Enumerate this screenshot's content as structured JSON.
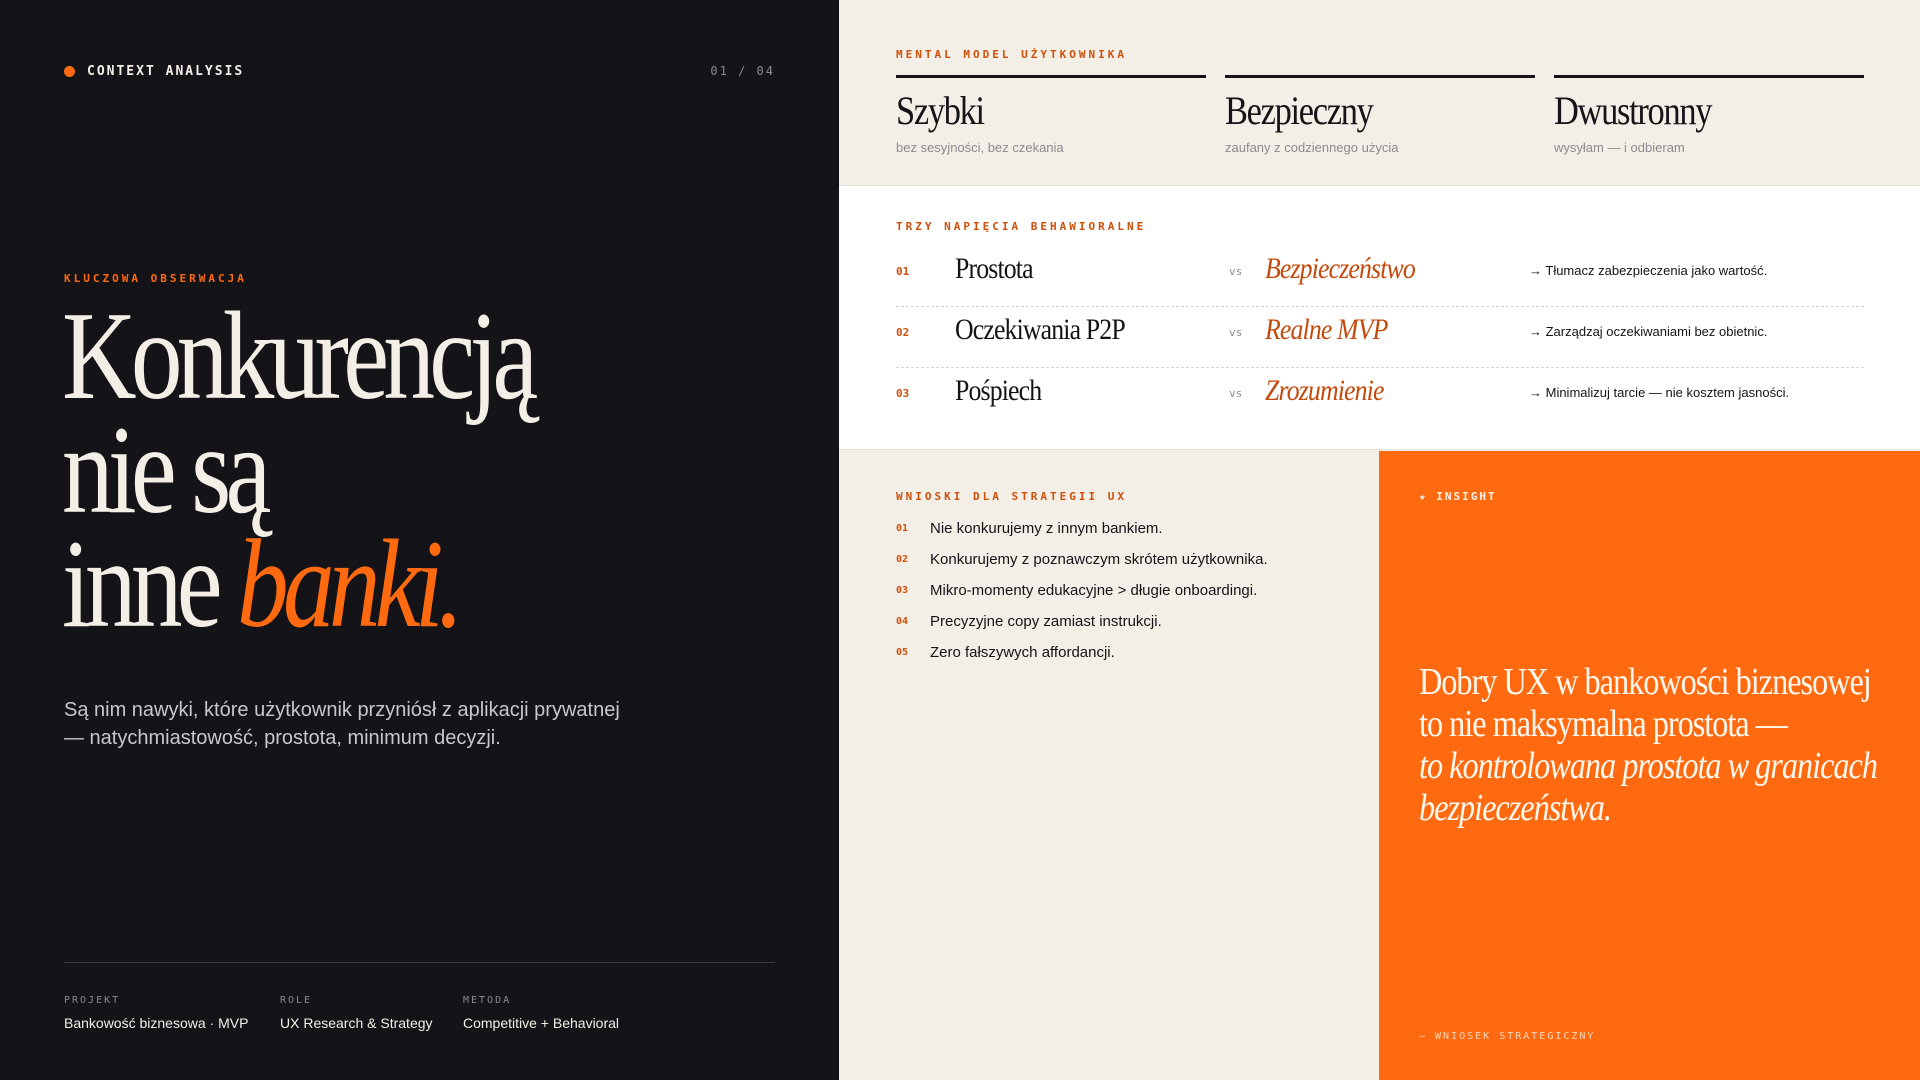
{
  "left": {
    "context_label": "CONTEXT ANALYSIS",
    "pager": "01 / 04",
    "kicker": "KLUCZOWA OBSERWACJA",
    "headline_line1": "Konkurencją",
    "headline_line2": "nie są",
    "headline_line3": "inne",
    "headline_accent": "banki.",
    "lead": "Są nim nawyki, które użytkownik przyniósł z aplikacji prywatnej — natychmiastowość, prostota, minimum decyzji.",
    "meta": [
      {
        "label": "PROJEKT",
        "value": "Bankowość biznesowa · MVP"
      },
      {
        "label": "ROLE",
        "value": "UX Research & Strategy"
      },
      {
        "label": "METODA",
        "value": "Competitive + Behavioral"
      }
    ]
  },
  "mental_model": {
    "label": "MENTAL MODEL UŻYTKOWNIKA",
    "items": [
      {
        "title": "Szybki",
        "subtitle": "bez sesyjności, bez czekania"
      },
      {
        "title": "Bezpieczny",
        "subtitle": "zaufany z codziennego użycia"
      },
      {
        "title": "Dwustronny",
        "subtitle": "wysyłam — i odbieram"
      }
    ]
  },
  "tensions": {
    "label": "TRZY NAPIĘCIA BEHAWIORALNE",
    "vs": "vs",
    "rows": [
      {
        "num": "01",
        "a": "Prostota",
        "b": "Bezpieczeństwo",
        "action": "→ Tłumacz zabezpieczenia jako wartość."
      },
      {
        "num": "02",
        "a": "Oczekiwania P2P",
        "b": "Realne MVP",
        "action": "→ Zarządzaj oczekiwaniami bez obietnic."
      },
      {
        "num": "03",
        "a": "Pośpiech",
        "b": "Zrozumienie",
        "action": "→ Minimalizuj tarcie — nie kosztem jasności."
      }
    ]
  },
  "strategy": {
    "label": "WNIOSKI DLA STRATEGII UX",
    "items": [
      {
        "num": "01",
        "text": "Nie konkurujemy z innym bankiem."
      },
      {
        "num": "02",
        "text": "Konkurujemy z poznawczym skrótem użytkownika."
      },
      {
        "num": "03",
        "text": "Mikro-momenty edukacyjne > długie onboardingi."
      },
      {
        "num": "04",
        "text": "Precyzyjne copy zamiast instrukcji."
      },
      {
        "num": "05",
        "text": "Zero fałszywych affordancji."
      }
    ]
  },
  "insight": {
    "tag": "★ INSIGHT",
    "quote_plain": "Dobry UX w bankowości biznesowej to nie maksymalna prostota —",
    "quote_italic": "to kontrolowana prostota w granicach bezpieczeństwa.",
    "footer": "— WNIOSEK STRATEGICZNY"
  },
  "colors": {
    "dark": "#141317",
    "cream": "#f3efe7",
    "accent": "#ff6a10",
    "accent_dark": "#c44a0c"
  }
}
